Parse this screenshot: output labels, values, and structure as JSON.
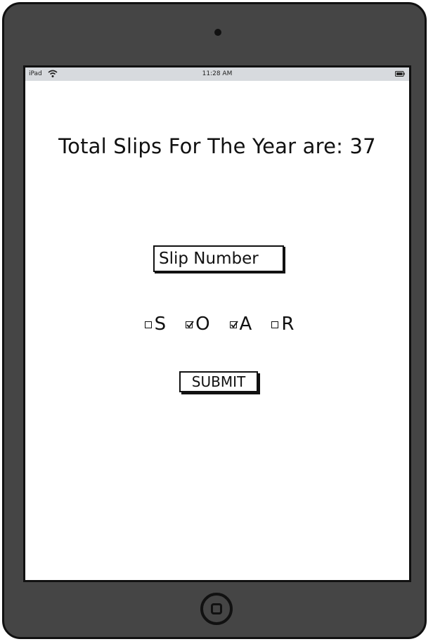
{
  "status_bar": {
    "device": "iPad",
    "time": "11:28 AM",
    "wifi_icon": "wifi-icon",
    "battery_icon": "battery-icon"
  },
  "main": {
    "title": "Total Slips For The Year are: 37",
    "slip_input": {
      "placeholder": "Slip Number",
      "value": ""
    },
    "options": [
      {
        "label": "S",
        "checked": false
      },
      {
        "label": "O",
        "checked": true
      },
      {
        "label": "A",
        "checked": true
      },
      {
        "label": "R",
        "checked": false
      }
    ],
    "submit_label": "SUBMIT"
  },
  "colors": {
    "device_body": "#454545",
    "status_bar": "#d7dade",
    "screen": "#ffffff",
    "ink": "#111111"
  }
}
